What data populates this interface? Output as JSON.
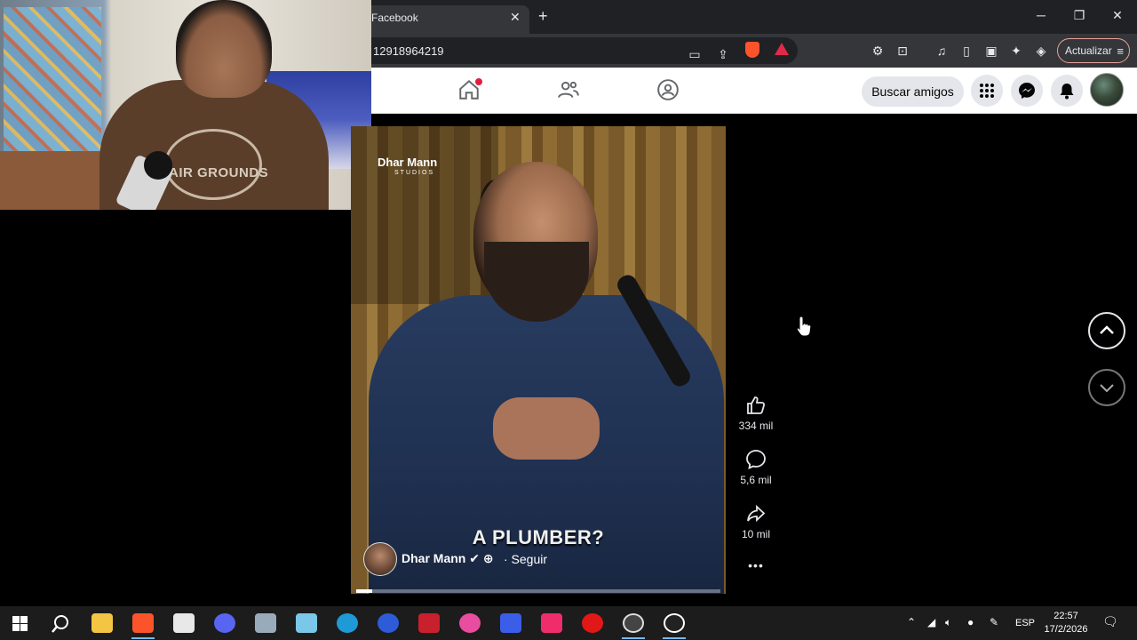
{
  "browser": {
    "tab_title": "Facebook",
    "tab_close": "✕",
    "new_tab": "+",
    "window_controls": {
      "minimize": "─",
      "maximize": "❐",
      "close": "✕"
    },
    "url": "12918964219",
    "update_button": "Actualizar",
    "update_menu": "≡",
    "brand_colors": {
      "shield": "#fb542b",
      "rewards": "#e02a49"
    }
  },
  "facebook": {
    "nav_icons": [
      "home-icon",
      "friends-icon",
      "groups-icon"
    ],
    "find_friends": "Buscar amigos",
    "header_buttons": [
      "menu-grid-icon",
      "messenger-icon",
      "notifications-icon"
    ],
    "accent": "#e41e3f"
  },
  "webcam": {
    "shirt_text": "AIR GROUNDS"
  },
  "video": {
    "brand": "Dhar Mann",
    "brand_sub": "STUDIOS",
    "caption": "A PLUMBER?",
    "author": "Dhar Mann",
    "author_badges": "✔ ⊕",
    "follow": "· Seguir",
    "progress_percent": 4.5
  },
  "actions": {
    "likes": "334 mil",
    "comments": "5,6 mil",
    "shares": "10 mil",
    "more": "•••"
  },
  "reel_nav": {
    "up": "chevron-up-icon",
    "down": "chevron-down-icon"
  },
  "taskbar": {
    "apps": [
      "start-icon",
      "search-icon",
      "file-explorer-icon",
      "brave-icon",
      "app-icon",
      "discord-icon",
      "app-icon",
      "notepad-icon",
      "edge-icon",
      "app-icon",
      "app-icon",
      "app-icon",
      "app-icon",
      "tiktok-icon",
      "app-icon",
      "app-icon",
      "obs-icon"
    ],
    "language": "ESP",
    "time": "22:57",
    "date": "17/2/2026"
  }
}
